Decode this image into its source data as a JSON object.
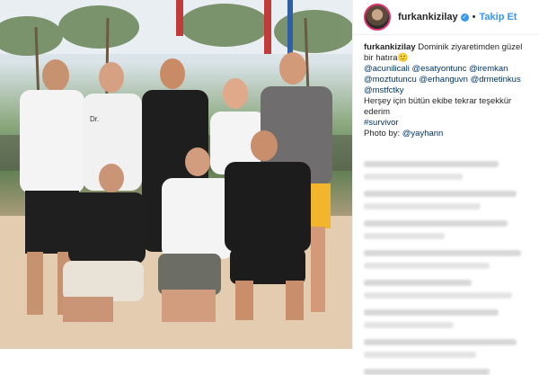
{
  "post": {
    "username": "furkankizilay",
    "verified_mark": "✓",
    "separator": "•",
    "follow_label": "Takip Et",
    "caption_text": "Dominik ziyaretimden güzel bir hatıra",
    "caption_emoji": "🙂",
    "mentions": [
      "@acunilicali",
      "@esatyontunc",
      "@iremkan",
      "@moztutuncu",
      "@erhanguvn",
      "@drmetinkus",
      "@mstfctky"
    ],
    "thanks_text": "Herşey için bütün ekibe tekrar teşekkür ederim",
    "hashtag": "#survivor",
    "photo_by_prefix": "Photo by:",
    "photo_by_user": "@yayhann",
    "photo_shirt_text": "Dr."
  },
  "colors": {
    "link": "#003569",
    "follow": "#3897f0",
    "text": "#262626",
    "story_ring": "#e1306c"
  }
}
